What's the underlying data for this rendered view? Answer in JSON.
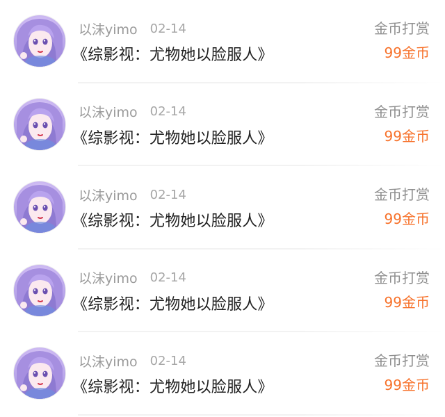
{
  "accent_color": "#f7722b",
  "records": [
    {
      "user": "以沫yimo",
      "date": "02-14",
      "title": "《综影视：尤物她以脸服人》",
      "type": "金币打赏",
      "amount": "99金币",
      "avatar_icon": "anime-girl-avatar"
    },
    {
      "user": "以沫yimo",
      "date": "02-14",
      "title": "《综影视：尤物她以脸服人》",
      "type": "金币打赏",
      "amount": "99金币",
      "avatar_icon": "anime-girl-avatar"
    },
    {
      "user": "以沫yimo",
      "date": "02-14",
      "title": "《综影视：尤物她以脸服人》",
      "type": "金币打赏",
      "amount": "99金币",
      "avatar_icon": "anime-girl-avatar"
    },
    {
      "user": "以沫yimo",
      "date": "02-14",
      "title": "《综影视：尤物她以脸服人》",
      "type": "金币打赏",
      "amount": "99金币",
      "avatar_icon": "anime-girl-avatar"
    },
    {
      "user": "以沫yimo",
      "date": "02-14",
      "title": "《综影视：尤物她以脸服人》",
      "type": "金币打赏",
      "amount": "99金币",
      "avatar_icon": "anime-girl-avatar"
    }
  ]
}
